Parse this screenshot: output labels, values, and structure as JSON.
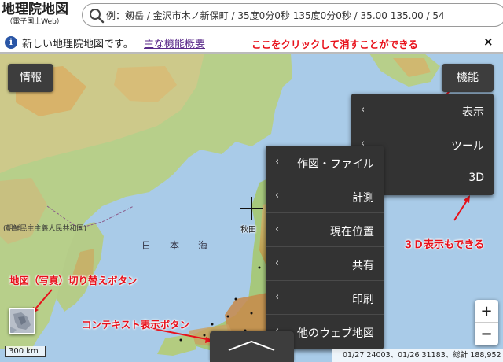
{
  "logo": {
    "title": "地理院地図",
    "subtitle": "（電子国土Web）"
  },
  "search": {
    "placeholder": "例：剱岳 / 金沢市木ノ新保町 / 35度0分0秒 135度0分0秒 / 35.00 135.00 / 54"
  },
  "info_bar": {
    "text": "新しい地理院地図です。",
    "link": "主な機能概要",
    "close": "×"
  },
  "buttons": {
    "info": "情報",
    "features": "機能"
  },
  "feature_menu": [
    "表示",
    "ツール",
    "3D"
  ],
  "tool_menu": [
    "作図・ファイル",
    "計測",
    "現在位置",
    "共有",
    "印刷",
    "他のウェブ地図"
  ],
  "annotations": {
    "close_hint": "ここをクリックして消すことができる",
    "3d_hint": "３Ｄ表示もできる",
    "photo_hint": "地図（写真）切り替えボタン",
    "context_hint": "コンテキスト表示ボタン"
  },
  "map_labels": {
    "sea": "日　本　海",
    "akita": "秋田",
    "country": "(朝鮮民主主義人民共和国)"
  },
  "scale": "300 km",
  "attribution": "01/27 24003、01/26 31183、総計 188,952",
  "colors": {
    "accent_red": "#e8101a",
    "menu_bg": "#333333",
    "button_bg": "#3d3d3d",
    "link_purple": "#5a2a8a"
  }
}
